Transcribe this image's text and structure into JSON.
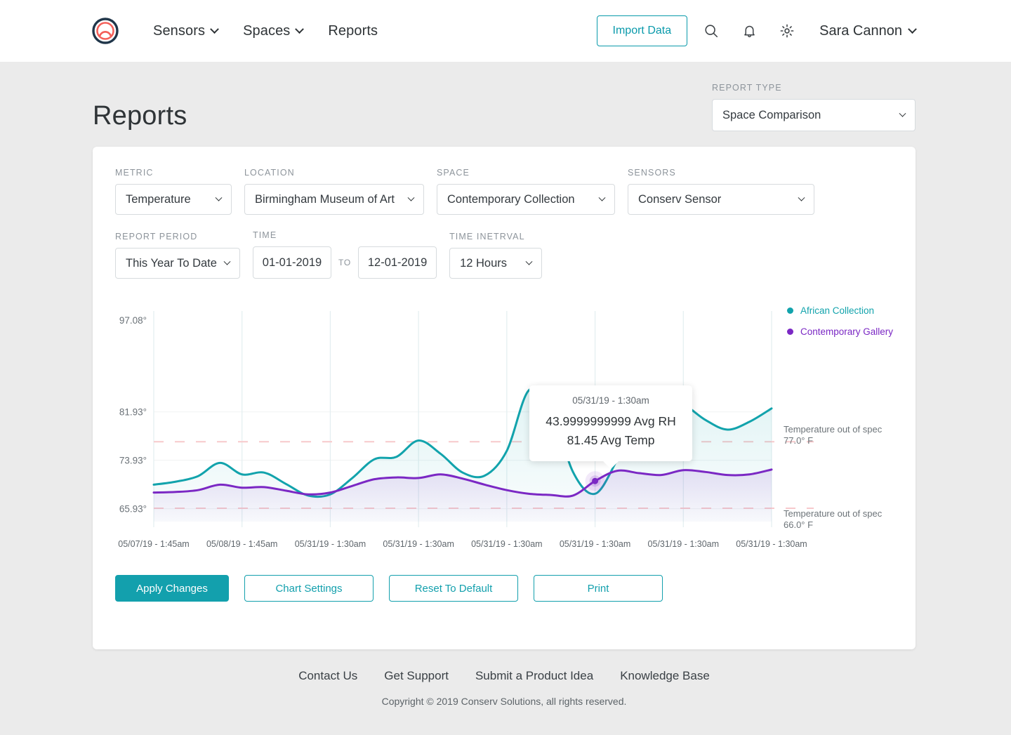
{
  "header": {
    "logo_name": "conserv-logo",
    "nav": [
      {
        "label": "Sensors",
        "has_chevron": true
      },
      {
        "label": "Spaces",
        "has_chevron": true
      },
      {
        "label": "Reports",
        "has_chevron": false
      }
    ],
    "import_label": "Import Data",
    "icons": [
      "search-icon",
      "bell-icon",
      "gear-icon"
    ],
    "user_name": "Sara Cannon"
  },
  "page": {
    "title": "Reports",
    "report_type_label": "REPORT TYPE",
    "report_type_value": "Space Comparison"
  },
  "filters": {
    "metric": {
      "label": "METRIC",
      "value": "Temperature"
    },
    "location": {
      "label": "LOCATION",
      "value": "Birmingham Museum of Art"
    },
    "space": {
      "label": "SPACE",
      "value": "Contemporary Collection"
    },
    "sensors": {
      "label": "SENSORS",
      "value": "Conserv Sensor"
    },
    "report_period": {
      "label": "REPORT PERIOD",
      "value": "This Year To Date"
    },
    "time": {
      "label": "TIME",
      "start": "01-01-2019",
      "to": "TO",
      "end": "12-01-2019"
    },
    "time_interval": {
      "label": "TIME INETRVAL",
      "value": "12 Hours"
    }
  },
  "chart_data": {
    "type": "line",
    "title": "",
    "xlabel": "",
    "ylabel": "",
    "ylim": [
      65.93,
      97.08
    ],
    "y_ticks": [
      "97.08°",
      "81.93°",
      "73.93°",
      "65.93°"
    ],
    "y_tick_values": [
      97.08,
      81.93,
      73.93,
      65.93
    ],
    "x_ticks": [
      "05/07/19 - 1:45am",
      "05/08/19 - 1:45am",
      "05/31/19 - 1:30am",
      "05/31/19 - 1:30am",
      "05/31/19 - 1:30am",
      "05/31/19 - 1:30am",
      "05/31/19 - 1:30am",
      "05/31/19 - 1:30am"
    ],
    "grid": true,
    "legend_position": "top-right",
    "series": [
      {
        "name": "African Collection",
        "color": "#12a3ac",
        "values": [
          69.9,
          70.4,
          71.3,
          73.5,
          71.6,
          71.9,
          70.0,
          68.1,
          68.3,
          71.0,
          74.1,
          74.5,
          77.2,
          75.0,
          71.9,
          71.4,
          75.5,
          85.5,
          82.7,
          72.0,
          68.4,
          74.0,
          81.5,
          84.3,
          83.2,
          80.6,
          79.0,
          80.3,
          82.5
        ]
      },
      {
        "name": "Contemporary Gallery",
        "color": "#7b28c4",
        "values": [
          68.6,
          68.7,
          69.0,
          69.9,
          69.4,
          69.5,
          68.9,
          68.3,
          68.6,
          69.7,
          70.8,
          71.1,
          71.0,
          71.6,
          70.9,
          69.9,
          69.0,
          68.4,
          68.2,
          68.1,
          70.5,
          72.2,
          71.8,
          71.5,
          72.3,
          72.0,
          71.5,
          71.6,
          72.4
        ]
      }
    ],
    "thresholds": [
      {
        "name": "Temperature out of spec",
        "label_line1": "Temperature out of spec",
        "label_line2": "77.0° F",
        "value": 77.0,
        "color": "#f7c9cc"
      },
      {
        "name": "Temperature out of spec",
        "label_line1": "Temperature out of spec",
        "label_line2": "66.0° F",
        "value": 66.0,
        "color": "#f7c9cc"
      }
    ],
    "tooltip": {
      "date": "05/31/19 - 1:30am",
      "line1": "43.9999999999 Avg RH",
      "line2": "81.45 Avg Temp"
    }
  },
  "actions": [
    {
      "label": "Apply Changes",
      "style": "primary"
    },
    {
      "label": "Chart Settings",
      "style": "outline"
    },
    {
      "label": "Reset To Default",
      "style": "outline"
    },
    {
      "label": "Print",
      "style": "outline"
    }
  ],
  "footer": {
    "links": [
      "Contact Us",
      "Get Support",
      "Submit a Product Idea",
      "Knowledge Base"
    ],
    "copyright": "Copyright © 2019 Conserv Solutions, all rights reserved."
  },
  "colors": {
    "brand_teal": "#13a0ad",
    "series_1": "#12a3ac",
    "series_2": "#7b28c4",
    "logo_red": "#f4605a",
    "logo_navy": "#20364a"
  }
}
